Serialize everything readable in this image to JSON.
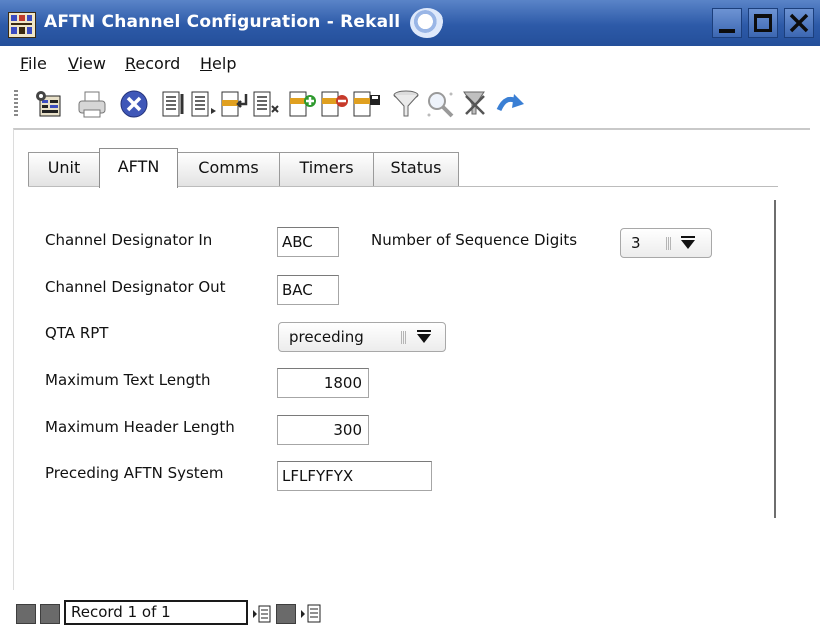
{
  "window": {
    "title": "AFTN Channel Configuration - Rekall"
  },
  "menu": [
    {
      "label": "File",
      "accel": "F",
      "rest": "ile"
    },
    {
      "label": "View",
      "accel": "V",
      "rest": "iew"
    },
    {
      "label": "Record",
      "accel": "R",
      "rest": "ecord"
    },
    {
      "label": "Help",
      "accel": "H",
      "rest": "elp"
    }
  ],
  "toolbar_icons": [
    "properties-icon",
    "print-icon",
    "cancel-icon",
    "first-record-icon",
    "previous-record-icon",
    "next-record-icon",
    "last-record-icon",
    "insert-record-icon",
    "delete-record-icon",
    "save-record-icon",
    "filter-icon",
    "search-icon",
    "clear-filter-icon",
    "redo-icon"
  ],
  "tabs": [
    "Unit",
    "AFTN",
    "Comms",
    "Timers",
    "Status"
  ],
  "active_tab": "AFTN",
  "form": {
    "channel_designator_in": {
      "label": "Channel Designator In",
      "value": "ABC"
    },
    "channel_designator_out": {
      "label": "Channel Designator Out",
      "value": "BAC"
    },
    "qta_rpt": {
      "label": "QTA RPT",
      "value": "preceding"
    },
    "max_text_length": {
      "label": "Maximum Text Length",
      "value": "1800"
    },
    "max_header_length": {
      "label": "Maximum Header Length",
      "value": "300"
    },
    "preceding_aftn_system": {
      "label": "Preceding AFTN System",
      "value": "LFLFYFYX"
    },
    "sequence_digits": {
      "label": "Number of Sequence Digits",
      "value": "3"
    }
  },
  "status": {
    "record_text": "Record 1 of 1"
  },
  "colors": {
    "titlebar": "#2d5aa8",
    "desktop": "#0b3f87",
    "cancel_blue": "#3f57b8"
  }
}
